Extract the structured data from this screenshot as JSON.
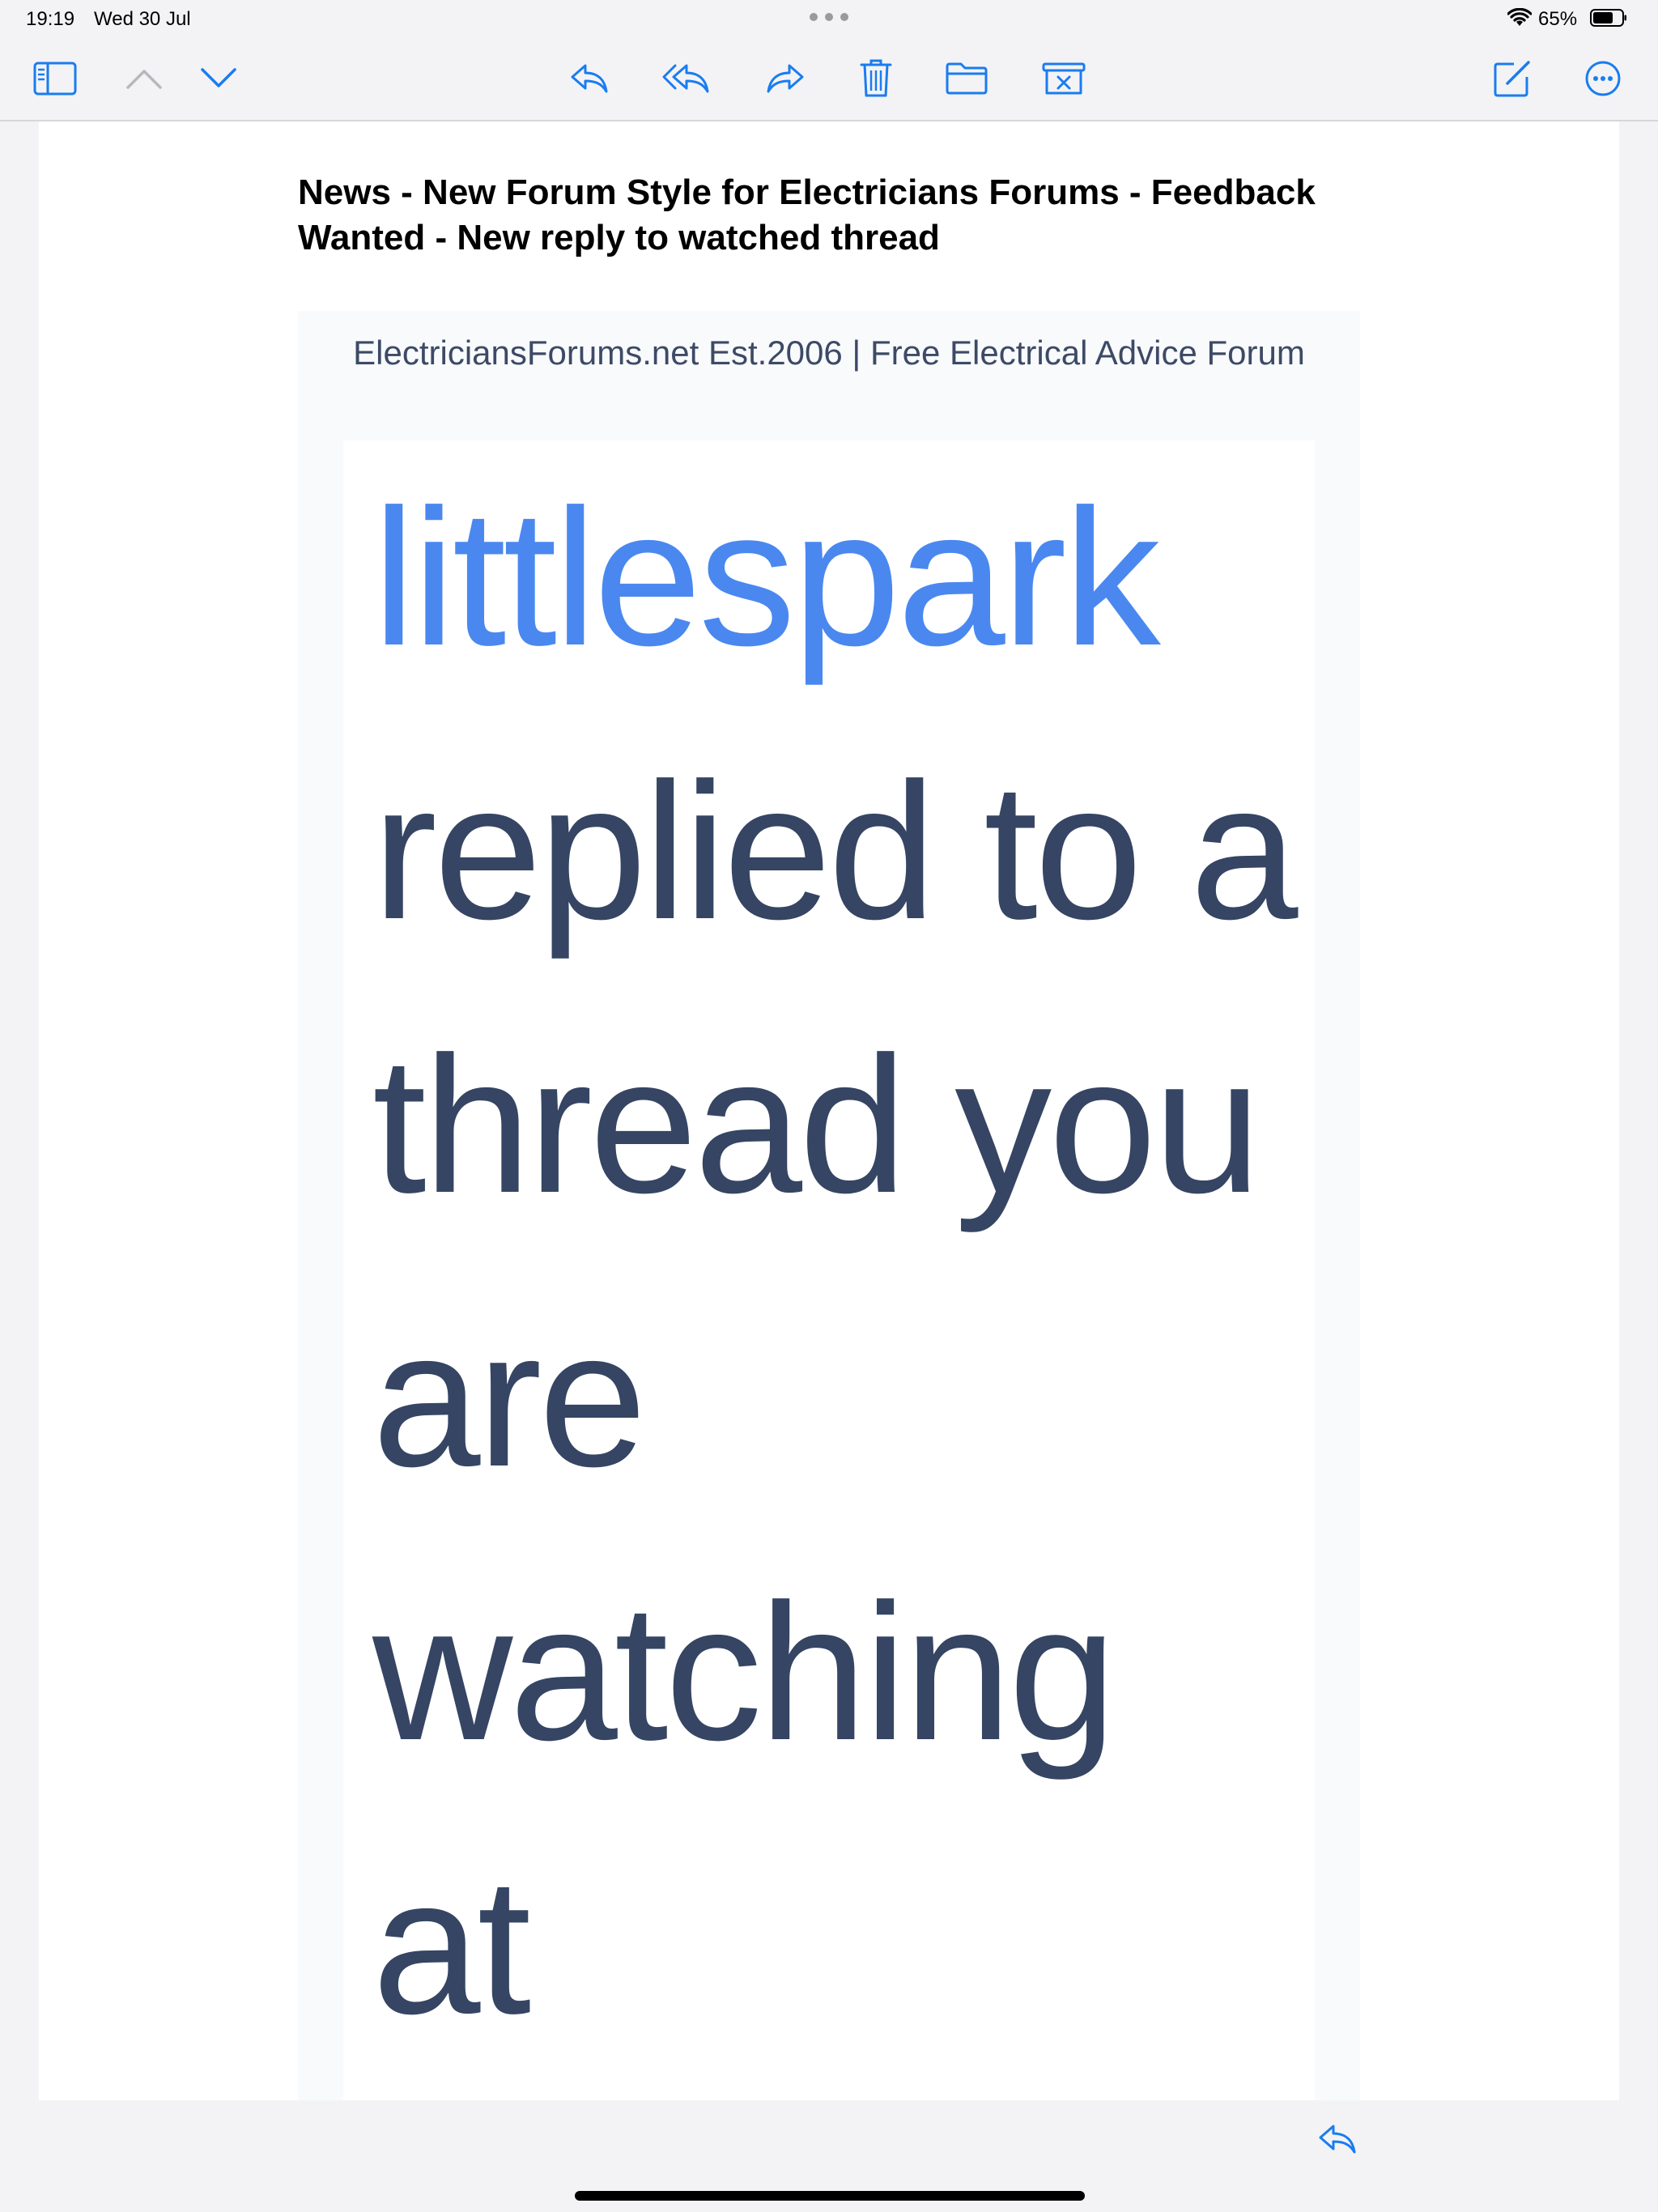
{
  "status_bar": {
    "time": "19:19",
    "date": "Wed 30 Jul",
    "battery": "65%"
  },
  "toolbar": {
    "icons": [
      "sidebar-icon",
      "chevron-up-icon",
      "chevron-down-icon",
      "reply-icon",
      "reply-all-icon",
      "forward-icon",
      "trash-icon",
      "folder-icon",
      "junk-icon",
      "compose-icon",
      "more-icon"
    ],
    "accent_color": "#1a7cf0",
    "disabled_color": "#b8b8bc"
  },
  "message": {
    "subject": "News - New Forum Style for Electricians Forums - Feedback Wanted - New reply to watched thread",
    "body": {
      "forum_header": "ElectriciansForums.net Est.2006 | Free Electrical Advice Forum",
      "username": "littlespark",
      "text": " replied to a thread you are watching at"
    },
    "colors": {
      "username": "#4a88f0",
      "body_text": "#354563"
    }
  }
}
